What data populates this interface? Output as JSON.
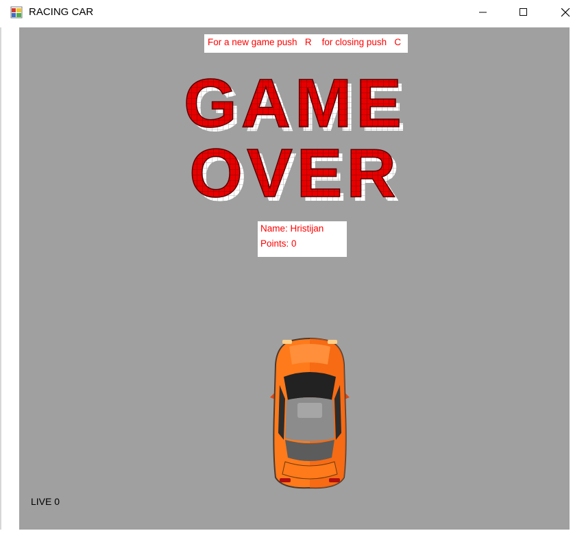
{
  "window": {
    "title": "RACING CAR",
    "icon": "winforms-app-icon",
    "controls": [
      "minimize",
      "maximize",
      "close"
    ]
  },
  "game": {
    "instruction": "For a new game push   R    for closing push   C",
    "banner_line1": "GAME",
    "banner_line2": "OVER",
    "player_name": "Name: Hristijan",
    "points": "Points: 0",
    "lives": "LIVE 0",
    "car_icon": "orange-sports-car-top-view"
  },
  "colors": {
    "background": "#a0a0a0",
    "banner_red": "#e60000",
    "text_red": "#ff0000",
    "car_orange": "#ff7a1a"
  }
}
